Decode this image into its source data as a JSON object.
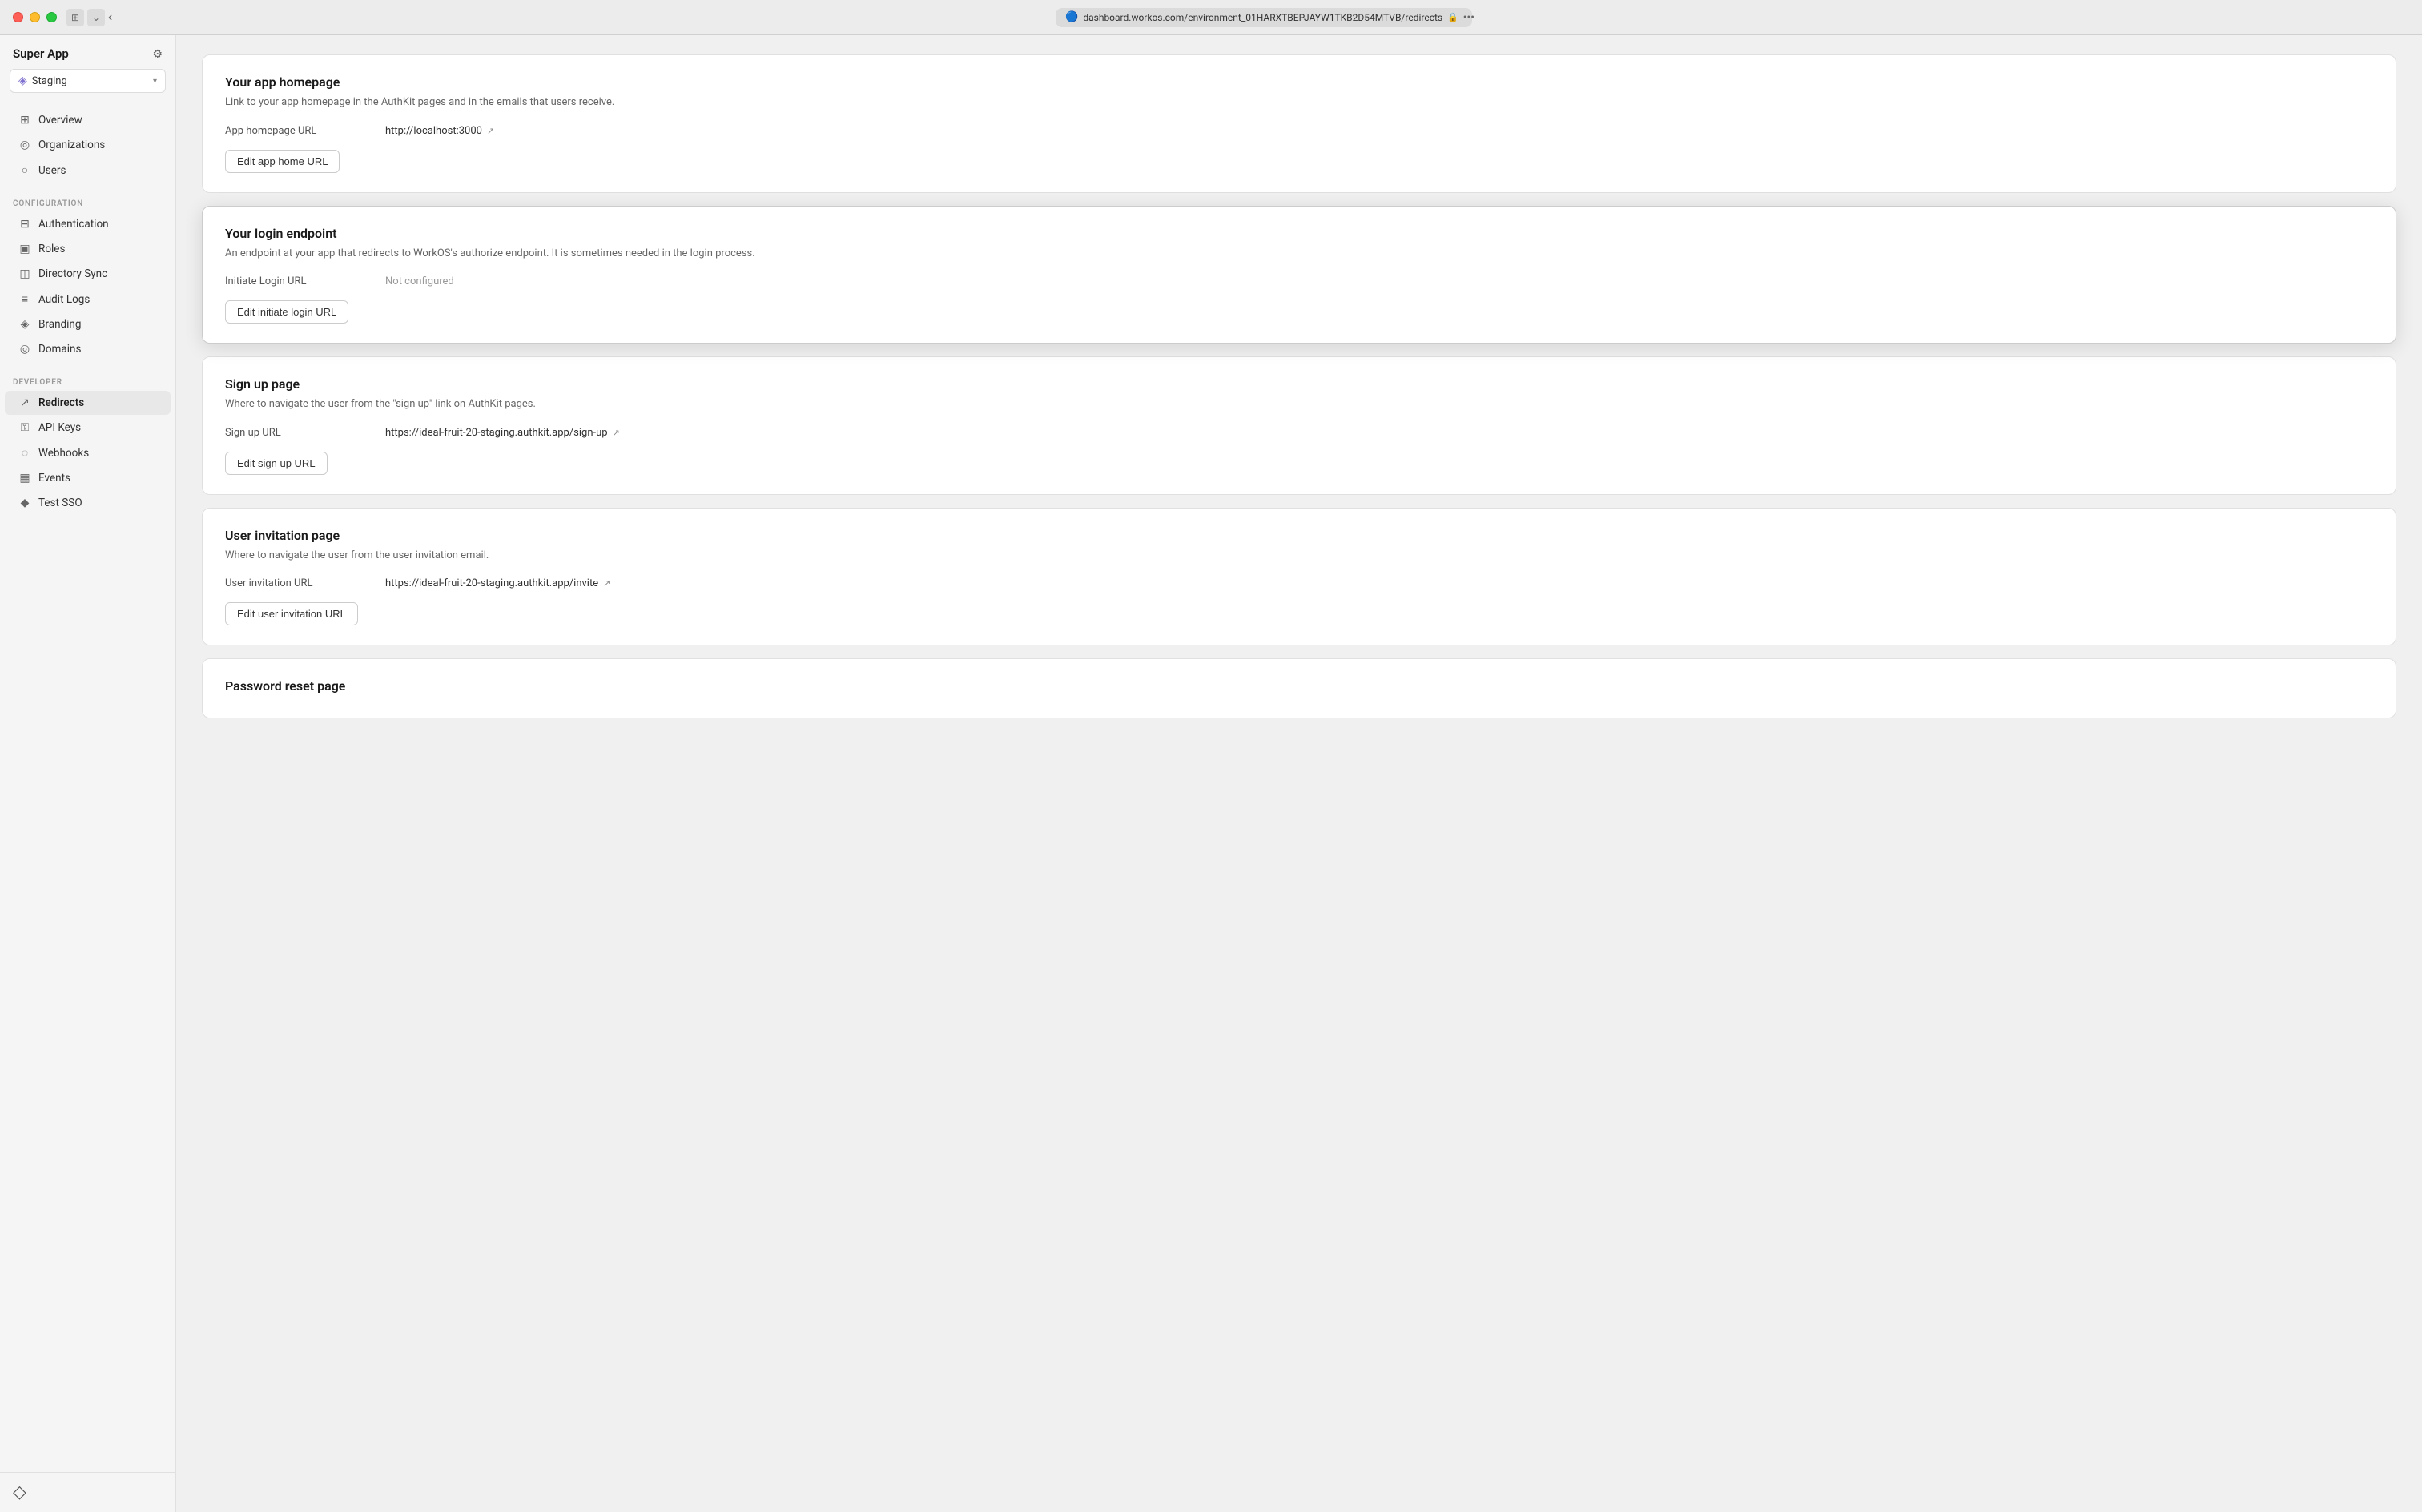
{
  "titlebar": {
    "url": "dashboard.workos.com/environment_01HARXTBEPJAYW1TKB2D54MTVB/redirects",
    "dots": [
      "red",
      "yellow",
      "green"
    ]
  },
  "sidebar": {
    "app_name": "Super App",
    "env_label": "Staging",
    "nav_items_top": [
      {
        "id": "overview",
        "label": "Overview",
        "icon": "⊞"
      },
      {
        "id": "organizations",
        "label": "Organizations",
        "icon": "◎"
      },
      {
        "id": "users",
        "label": "Users",
        "icon": "○"
      }
    ],
    "config_label": "CONFIGURATION",
    "config_items": [
      {
        "id": "authentication",
        "label": "Authentication",
        "icon": "⊟"
      },
      {
        "id": "roles",
        "label": "Roles",
        "icon": "▣"
      },
      {
        "id": "directory-sync",
        "label": "Directory Sync",
        "icon": "◫"
      },
      {
        "id": "audit-logs",
        "label": "Audit Logs",
        "icon": "≡"
      },
      {
        "id": "branding",
        "label": "Branding",
        "icon": "◈"
      },
      {
        "id": "domains",
        "label": "Domains",
        "icon": "◎"
      }
    ],
    "developer_label": "DEVELOPER",
    "developer_items": [
      {
        "id": "redirects",
        "label": "Redirects",
        "icon": "↗",
        "active": true
      },
      {
        "id": "api-keys",
        "label": "API Keys",
        "icon": "⚿"
      },
      {
        "id": "webhooks",
        "label": "Webhooks",
        "icon": "◌"
      },
      {
        "id": "events",
        "label": "Events",
        "icon": "▦"
      },
      {
        "id": "test-sso",
        "label": "Test SSO",
        "icon": "◆"
      }
    ]
  },
  "cards": {
    "app_homepage": {
      "title": "Your app homepage",
      "subtitle": "Link to your app homepage in the AuthKit pages and in the emails that users receive.",
      "field_label": "App homepage URL",
      "field_value": "http://localhost:3000",
      "button_label": "Edit app home URL"
    },
    "login_endpoint": {
      "title": "Your login endpoint",
      "subtitle": "An endpoint at your app that redirects to WorkOS's authorize endpoint. It is sometimes needed in the login process.",
      "field_label": "Initiate Login URL",
      "field_value": "Not configured",
      "button_label": "Edit initiate login URL"
    },
    "signup_page": {
      "title": "Sign up page",
      "subtitle": "Where to navigate the user from the \"sign up\" link on AuthKit pages.",
      "field_label": "Sign up URL",
      "field_value": "https://ideal-fruit-20-staging.authkit.app/sign-up",
      "button_label": "Edit sign up URL"
    },
    "user_invitation": {
      "title": "User invitation page",
      "subtitle": "Where to navigate the user from the user invitation email.",
      "field_label": "User invitation URL",
      "field_value": "https://ideal-fruit-20-staging.authkit.app/invite",
      "button_label": "Edit user invitation URL"
    },
    "password_reset": {
      "title": "Password reset page",
      "subtitle": ""
    }
  }
}
